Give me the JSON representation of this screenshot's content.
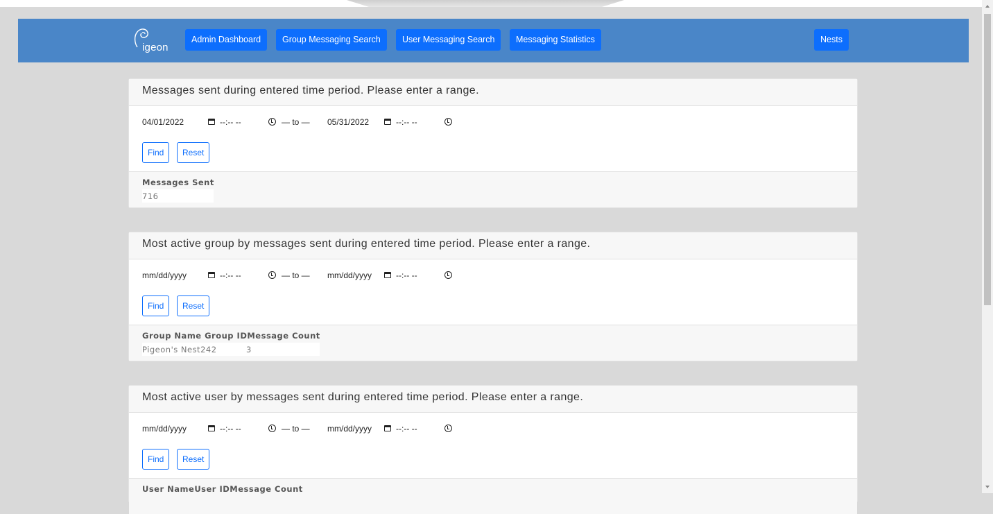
{
  "navbar": {
    "brand_text": "igeon",
    "items": [
      {
        "label": "Admin Dashboard"
      },
      {
        "label": "Group Messaging Search"
      },
      {
        "label": "User Messaging Search"
      },
      {
        "label": "Messaging Statistics"
      },
      {
        "label": "Nests"
      }
    ],
    "color": "#4a86c8",
    "button_color": "#0d6efd"
  },
  "icons": {
    "date_picker": "calendar-icon",
    "time_picker": "clock-icon",
    "brand": "pigeon-logo-icon"
  },
  "cards": [
    {
      "title": "Messages sent during entered time period. Please enter a range.",
      "start_date": "04/01/2022",
      "start_time": "--:-- --",
      "separator": "— to —",
      "end_date": "05/31/2022",
      "end_time": "--:-- --",
      "find_label": "Find",
      "reset_label": "Reset",
      "result_header": "Messages Sent",
      "result_values": [
        "716"
      ]
    },
    {
      "title": "Most active group by messages sent during entered time period. Please enter a range.",
      "start_date": "mm/dd/yyyy",
      "start_time": "--:-- --",
      "separator": "— to —",
      "end_date": "mm/dd/yyyy",
      "end_time": "--:-- --",
      "find_label": "Find",
      "reset_label": "Reset",
      "result_header": "Group Name Group IDMessage Count",
      "result_values": [
        "Pigeon's Nest242",
        "3"
      ]
    },
    {
      "title": "Most active user by messages sent during entered time period. Please enter a range.",
      "start_date": "mm/dd/yyyy",
      "start_time": "--:-- --",
      "separator": "— to —",
      "end_date": "mm/dd/yyyy",
      "end_time": "--:-- --",
      "find_label": "Find",
      "reset_label": "Reset",
      "result_header": "User NameUser IDMessage Count"
    }
  ]
}
